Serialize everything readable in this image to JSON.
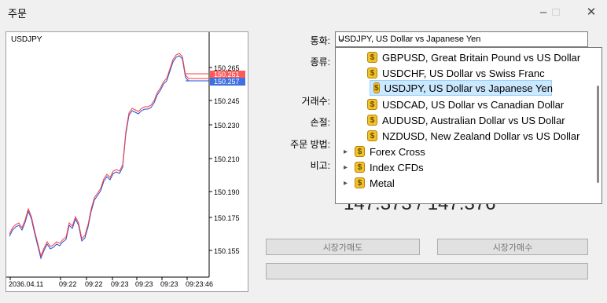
{
  "window": {
    "title": "주문"
  },
  "chart": {
    "symbol": "USDJPY",
    "ask_tag": "150.261",
    "bid_tag": "150.257",
    "price_ticks": [
      "150.265",
      "150.245",
      "150.230",
      "150.210",
      "150.190",
      "150.175",
      "150.155"
    ],
    "time_ticks": [
      "2036.04.11",
      "09:22",
      "09:22",
      "09:23",
      "09:23",
      "09:23",
      "09:23:46"
    ],
    "colors": {
      "ask": "#ff3b3b",
      "bid": "#1f4fd6",
      "ask_tag_bg": "#ff5a5a",
      "bid_tag_bg": "#3f6fe0"
    }
  },
  "form": {
    "symbol_label": "통화:",
    "type_label": "종류:",
    "volume_label": "거래수:",
    "sl_label": "손절:",
    "method_label": "주문 방법:",
    "comment_label": "비고:",
    "symbol_value": "USDJPY, US Dollar vs Japanese Yen"
  },
  "dropdown": {
    "items": [
      {
        "label": "GBPUSD, Great Britain Pound vs US Dollar",
        "type": "symbol"
      },
      {
        "label": "USDCHF, US Dollar vs Swiss Franc",
        "type": "symbol"
      },
      {
        "label": "USDJPY, US Dollar vs Japanese Yen",
        "type": "symbol",
        "selected": true
      },
      {
        "label": "USDCAD, US Dollar vs Canadian Dollar",
        "type": "symbol"
      },
      {
        "label": "AUDUSD, Australian Dollar vs US Dollar",
        "type": "symbol"
      },
      {
        "label": "NZDUSD, New Zealand Dollar vs US Dollar",
        "type": "symbol"
      },
      {
        "label": "Forex Cross",
        "type": "group"
      },
      {
        "label": "Index CFDs",
        "type": "group"
      },
      {
        "label": "Metal",
        "type": "group"
      }
    ]
  },
  "quote": {
    "text": "147.373 / 147.376"
  },
  "buttons": {
    "sell": "시장가매도",
    "buy": "시장가매수",
    "extra": ""
  }
}
